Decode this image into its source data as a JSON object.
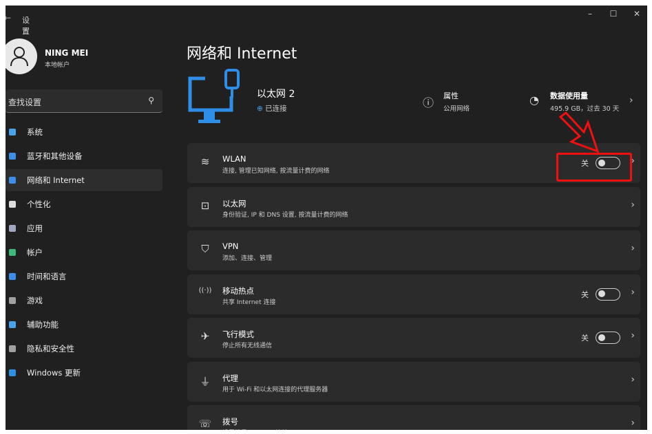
{
  "window": {
    "title": "设置",
    "minimize": "–",
    "maximize": "☐",
    "close": "✕"
  },
  "user": {
    "name": "NING MEI",
    "type": "本地帐户"
  },
  "search": {
    "placeholder": "查找设置"
  },
  "sidebar": {
    "items": [
      {
        "label": "系统",
        "color": "#4aa3ea"
      },
      {
        "label": "蓝牙和其他设备",
        "color": "#3c8ee8"
      },
      {
        "label": "网络和 Internet",
        "color": "#3c8ee8",
        "selected": true
      },
      {
        "label": "个性化",
        "color": "#dddddd"
      },
      {
        "label": "应用",
        "color": "#a0a8c0"
      },
      {
        "label": "帐户",
        "color": "#3cb878"
      },
      {
        "label": "时间和语言",
        "color": "#3c8ee8"
      },
      {
        "label": "游戏",
        "color": "#a0a0a0"
      },
      {
        "label": "辅助功能",
        "color": "#4aa3ea"
      },
      {
        "label": "隐私和安全性",
        "color": "#a0a0a0"
      },
      {
        "label": "Windows 更新",
        "color": "#2f8fe0"
      }
    ]
  },
  "page": {
    "title": "网络和 Internet"
  },
  "ethernet": {
    "name": "以太网 2",
    "status": "已连接"
  },
  "properties": {
    "title": "属性",
    "value": "公用网络"
  },
  "data_usage": {
    "title": "数据使用量",
    "value": "495.9 GB，过去 30 天"
  },
  "cards": [
    {
      "icon": "wifi-icon",
      "glyph": "≋",
      "title": "WLAN",
      "desc": "连接, 管理已知网络, 按流量计费的网络",
      "toggle": "关",
      "on": false
    },
    {
      "icon": "ethernet-icon",
      "glyph": "⊡",
      "title": "以太网",
      "desc": "身份验证, IP 和 DNS 设置, 按流量计费的网络"
    },
    {
      "icon": "vpn-shield-icon",
      "glyph": "⛉",
      "title": "VPN",
      "desc": "添加、连接、管理"
    },
    {
      "icon": "hotspot-icon",
      "glyph": "((·))",
      "title": "移动热点",
      "desc": "共享 Internet 连接",
      "toggle": "关",
      "on": false
    },
    {
      "icon": "airplane-icon",
      "glyph": "✈",
      "title": "飞行模式",
      "desc": "停止所有无线通信",
      "toggle": "关",
      "on": false
    },
    {
      "icon": "proxy-icon",
      "glyph": "⏚",
      "title": "代理",
      "desc": "用于 Wi-Fi 和以太网连接的代理服务器"
    },
    {
      "icon": "dialup-icon",
      "glyph": "☏",
      "title": "拨号",
      "desc": "设置拨号 Internet 连接"
    }
  ]
}
